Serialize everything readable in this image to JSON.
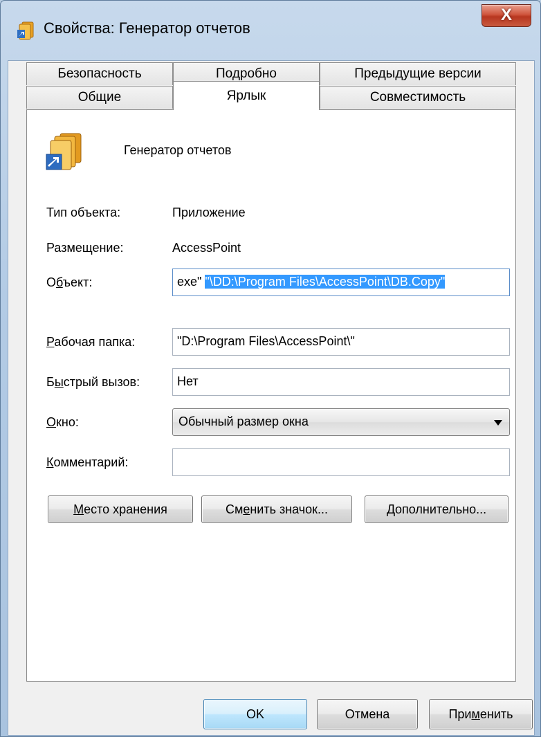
{
  "window": {
    "title": "Свойства: Генератор отчетов",
    "close_glyph": "X"
  },
  "tabs": {
    "row_back": [
      "Безопасность",
      "Подробно",
      "Предыдущие версии"
    ],
    "row_front": [
      "Общие",
      "Ярлык",
      "Совместимость"
    ],
    "active": "Ярлык"
  },
  "shortcut": {
    "name": "Генератор отчетов",
    "type_label": "Тип объекта:",
    "type_value": "Приложение",
    "location_label": "Размещение:",
    "location_value": "AccessPoint",
    "target_label_pre": "О",
    "target_label_acc": "б",
    "target_label_post": "ъект:",
    "target_value_plain": "exe\" ",
    "target_value_selected": "\"\\DD:\\Program Files\\AccessPoint\\DB.Copy\"",
    "start_in_label_acc": "Р",
    "start_in_label_post": "абочая папка:",
    "start_in_value": "\"D:\\Program Files\\AccessPoint\\\"",
    "hotkey_label_pre": "Б",
    "hotkey_label_acc": "ы",
    "hotkey_label_post": "стрый вызов:",
    "hotkey_value": "Нет",
    "run_label_acc": "О",
    "run_label_post": "кно:",
    "run_value": "Обычный размер окна",
    "comment_label_acc": "К",
    "comment_label_post": "омментарий:",
    "comment_value": ""
  },
  "buttons": {
    "open_location_acc": "М",
    "open_location_post": "есто хранения",
    "change_icon_pre": "См",
    "change_icon_acc": "е",
    "change_icon_post": "нить значок...",
    "advanced_acc": "Д",
    "advanced_post": "ополнительно...",
    "ok": "OK",
    "cancel": "Отмена",
    "apply_pre": "При",
    "apply_acc": "м",
    "apply_post": "енить"
  },
  "colors": {
    "selection": "#3399ff",
    "close_button": "#c8452b",
    "default_button": "#3c7fb1"
  },
  "icons": [
    "folder-stack-icon",
    "shortcut-arrow-icon",
    "close-icon",
    "dropdown-arrow-icon"
  ]
}
